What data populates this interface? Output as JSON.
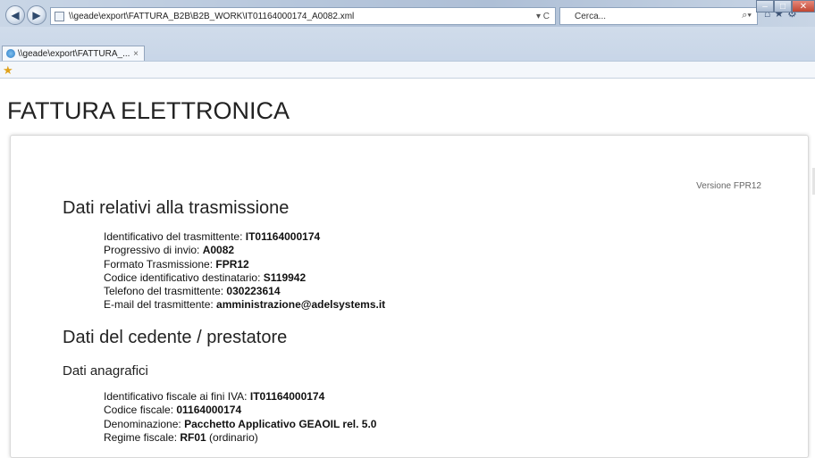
{
  "browser": {
    "address": "\\\\geade\\export\\FATTURA_B2B\\B2B_WORK\\IT01164000174_A0082.xml",
    "address_tools": "▾ C",
    "search_placeholder": "Cerca...",
    "tab_label": "\\\\geade\\export\\FATTURA_...",
    "tab_close": "×",
    "icons": [
      "back-icon",
      "forward-icon",
      "page-icon",
      "refresh-icon",
      "search-icon",
      "home-icon",
      "favorites-icon",
      "settings-icon",
      "add-favorite-icon"
    ]
  },
  "document": {
    "title": "FATTURA ELETTRONICA",
    "version": "Versione FPR12",
    "section1": {
      "heading": "Dati relativi alla trasmissione",
      "rows": [
        {
          "label": "Identificativo del trasmittente: ",
          "value": "IT01164000174",
          "suffix": ""
        },
        {
          "label": "Progressivo di invio: ",
          "value": "A0082",
          "suffix": ""
        },
        {
          "label": "Formato Trasmissione: ",
          "value": "FPR12",
          "suffix": ""
        },
        {
          "label": "Codice identificativo destinatario: ",
          "value": "S119942",
          "suffix": ""
        },
        {
          "label": "Telefono del trasmittente: ",
          "value": "030223614",
          "suffix": ""
        },
        {
          "label": "E-mail del trasmittente: ",
          "value": "amministrazione@adelsystems.it",
          "suffix": ""
        }
      ]
    },
    "section2": {
      "heading": "Dati del cedente / prestatore",
      "subheading": "Dati anagrafici",
      "rows": [
        {
          "label": "Identificativo fiscale ai fini IVA: ",
          "value": "IT01164000174",
          "suffix": ""
        },
        {
          "label": "Codice fiscale: ",
          "value": "01164000174",
          "suffix": ""
        },
        {
          "label": "Denominazione: ",
          "value": "Pacchetto Applicativo GEAOIL rel. 5.0",
          "suffix": ""
        },
        {
          "label": "Regime fiscale: ",
          "value": "RF01",
          "suffix": " (ordinario)"
        }
      ]
    }
  }
}
